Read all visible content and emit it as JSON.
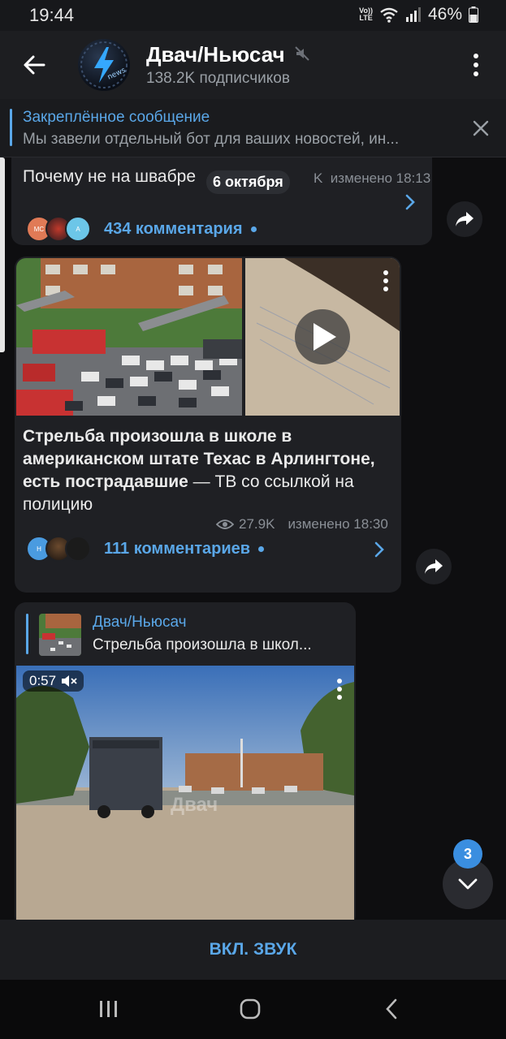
{
  "status": {
    "time": "19:44",
    "volte": "Vo)) LTE",
    "battery": "46%"
  },
  "header": {
    "title": "Двач/Ньюсач",
    "subscribers": "138.2K подписчиков"
  },
  "pinned": {
    "title": "Закреплённое сообщение",
    "text": "Мы завели отдельный бот для ваших новостей, ин..."
  },
  "posts": [
    {
      "text": "Почему не на швабре",
      "date_pill": "6 октября",
      "meta_suffix": "K",
      "edited": "изменено 18:13",
      "comment_avatars": [
        "MC",
        "",
        "A"
      ],
      "comments": "434 комментария"
    },
    {
      "headline_bold": "Стрельба произошла в школе в американском штате Техас в Арлингтоне, есть пострадавшие",
      "headline_rest": " — ТВ со ссылкой на полицию",
      "views": "27.9K",
      "edited": "изменено 18:30",
      "comment_avatars": [
        "H",
        "",
        ""
      ],
      "comments": "111 комментариев"
    },
    {
      "forward_from": "Двач/Ньюсач",
      "forward_text": "Стрельба произошла в школ...",
      "video_time": "0:57",
      "watermark": "Двач"
    }
  ],
  "unread_badge": "3",
  "unmute_label": "ВКЛ. ЗВУК",
  "colors": {
    "accent": "#5aa7e8",
    "bubble": "#1f2024",
    "background": "#0e0e10"
  },
  "icons": [
    "back-arrow-icon",
    "mute-icon",
    "more-vert-icon",
    "close-icon",
    "share-icon",
    "chevron-right-icon",
    "play-icon",
    "eye-icon",
    "volume-off-icon",
    "chevron-down-icon",
    "recent-apps-icon",
    "home-icon",
    "back-nav-icon"
  ]
}
